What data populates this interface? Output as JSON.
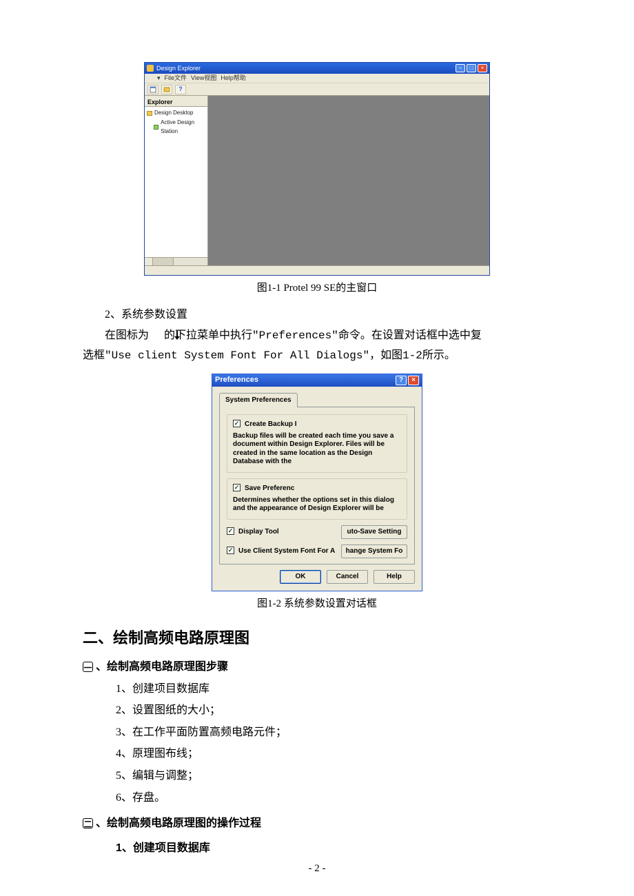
{
  "fig1": {
    "title": "Design Explorer",
    "menus": [
      "File文件",
      "View视图",
      "Help帮助"
    ],
    "sidebar_tab": "Explorer",
    "tree": [
      {
        "label": "Design Desktop",
        "type": "folder"
      },
      {
        "label": "Active Design Station",
        "type": "chip"
      }
    ],
    "caption": "图1-1 Protel 99 SE的主窗口"
  },
  "para_num2": "2、系统参数设置",
  "para_body_1a": "在图标为 ",
  "para_body_1b": " 的下拉菜单中执行\"Preferences\"命令。在设置对话框中选中复",
  "para_body_2": "选框\"Use client System Font For All Dialogs\"，如图1-2所示。",
  "fig2": {
    "title": "Preferences",
    "tab": "System Preferences",
    "check_backup": "Create Backup I",
    "desc_backup": "Backup files will be created each time you save a document within Design Explorer. Files will be created in the same location as the Design Database with the",
    "check_save": "Save Preferenc",
    "desc_save": "Determines whether the options set in this dialog and the appearance of Design Explorer will be",
    "check_display": "Display Tool",
    "btn_autosave": "uto-Save Setting",
    "check_font": "Use Client System Font For A",
    "btn_changefont": "hange System Fo",
    "btn_ok": "OK",
    "btn_cancel": "Cancel",
    "btn_help": "Help",
    "caption": "图1-2  系统参数设置对话框"
  },
  "h1": "二、绘制高频电路原理图",
  "h2a_label": "、绘制高频电路原理图步骤",
  "h2a_num": "一",
  "steps_a": [
    "1、创建项目数据库",
    "2、设置图纸的大小；",
    "3、在工作平面防置高频电路元件；",
    "4、原理图布线；",
    "5、编辑与调整；",
    "6、存盘。"
  ],
  "h2b_label": "、绘制高频电路原理图的操作过程",
  "h2b_num": "二",
  "h3_b1": "1、创建项目数据库",
  "page_number": "- 2 -"
}
